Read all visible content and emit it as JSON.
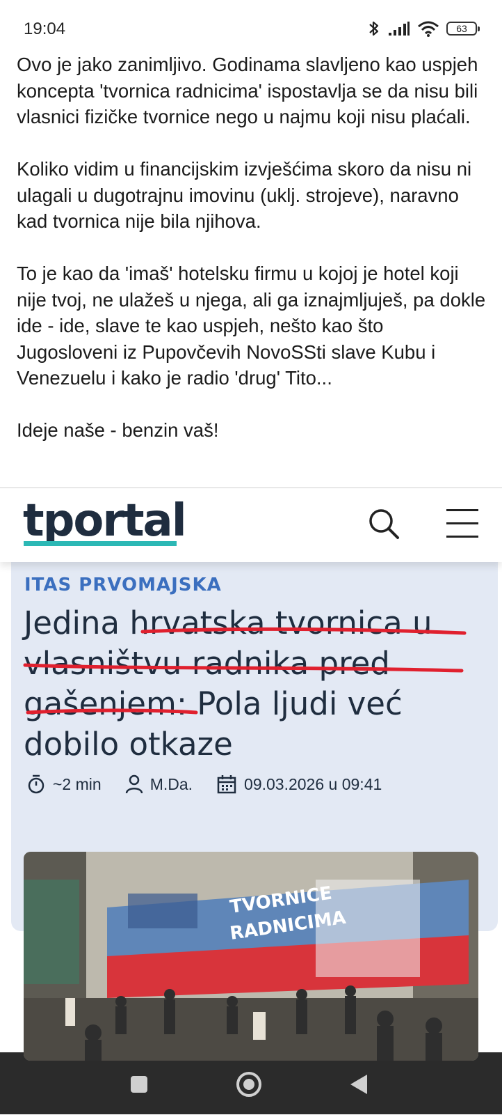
{
  "status_bar": {
    "time": "19:04",
    "battery": "63",
    "icons": [
      "bluetooth-icon",
      "signal-icon",
      "wifi-icon",
      "battery-icon"
    ]
  },
  "post": {
    "paragraphs": [
      "Ovo je jako zanimljivo. Godinama slavljeno kao uspjeh koncepta 'tvornica radnicima' ispostavlja se da nisu bili vlasnici fizičke tvornice nego u najmu koji nisu plaćali.",
      "Koliko vidim u financijskim izvješćima skoro da nisu ni ulagali u dugotrajnu imovinu (uklj. strojeve), naravno kad tvornica nije bila njihova.",
      "To je kao da 'imaš' hotelsku firmu u kojoj je hotel koji nije tvoj, ne ulažeš u njega, ali ga iznajmljuješ, pa dokle ide - ide, slave te kao uspjeh, nešto kao što Jugosloveni iz Pupovčevih NovoSSti slave Kubu i Venezuelu i kako je radio 'drug' Tito...",
      "Ideje naše - benzin vaš!"
    ]
  },
  "site": {
    "logo": "tportal",
    "accent_color": "#2cb8b5",
    "text_color": "#1f2d3f"
  },
  "article": {
    "category": "ITAS PRVOMAJSKA",
    "category_color": "#3b6fbf",
    "headline": "Jedina hrvatska tvornica u vlasništvu radnika pred gašenjem: Pola ljudi već dobilo otkaze",
    "underline_color": "#e0202e",
    "read_time": "~2 min",
    "author": "M.Da.",
    "date": "09.03.2026 u 09:41",
    "image_mural_text": [
      "TVORNICE",
      "RADNICIMA"
    ]
  },
  "nav": {
    "icons": [
      "recent-apps-icon",
      "home-icon",
      "back-icon"
    ]
  }
}
